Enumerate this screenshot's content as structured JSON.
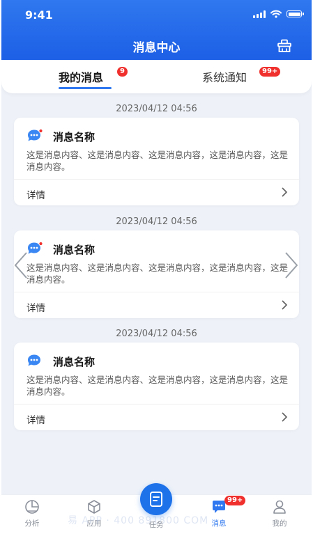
{
  "status_bar": {
    "time": "9:41"
  },
  "header": {
    "title": "消息中心",
    "action_icon": "clear-messages-icon"
  },
  "tabs": [
    {
      "label": "我的消息",
      "badge": "9",
      "active": true
    },
    {
      "label": "系统通知",
      "badge": "99+",
      "active": false
    }
  ],
  "messages": [
    {
      "time": "2023/04/12 04:56",
      "title": "消息名称",
      "content": "这是消息内容、这是消息内容、这是消息内容，这是消息内容，这是消息内容。",
      "detail": "详情",
      "unread": true
    },
    {
      "time": "2023/04/12 04:56",
      "title": "消息名称",
      "content": "这是消息内容、这是消息内容、这是消息内容，这是消息内容，这是消息内容。",
      "detail": "详情",
      "unread": true
    },
    {
      "time": "2023/04/12 04:56",
      "title": "消息名称",
      "content": "这是消息内容、这是消息内容、这是消息内容，这是消息内容，这是消息内容。",
      "detail": "详情",
      "unread": false
    }
  ],
  "tabbar": {
    "items": [
      {
        "label": "分析",
        "icon": "chart-pie-icon"
      },
      {
        "label": "应用",
        "icon": "cube-icon"
      },
      {
        "label": "任务",
        "icon": "task-icon"
      },
      {
        "label": "消息",
        "icon": "message-icon",
        "badge": "99+",
        "active": true
      },
      {
        "label": "我的",
        "icon": "user-icon"
      }
    ]
  },
  "watermark": "易 APP · 400 891800 COM",
  "colors": {
    "primary": "#2f78ef",
    "badge": "#f0302c",
    "background": "#eef2f8"
  }
}
